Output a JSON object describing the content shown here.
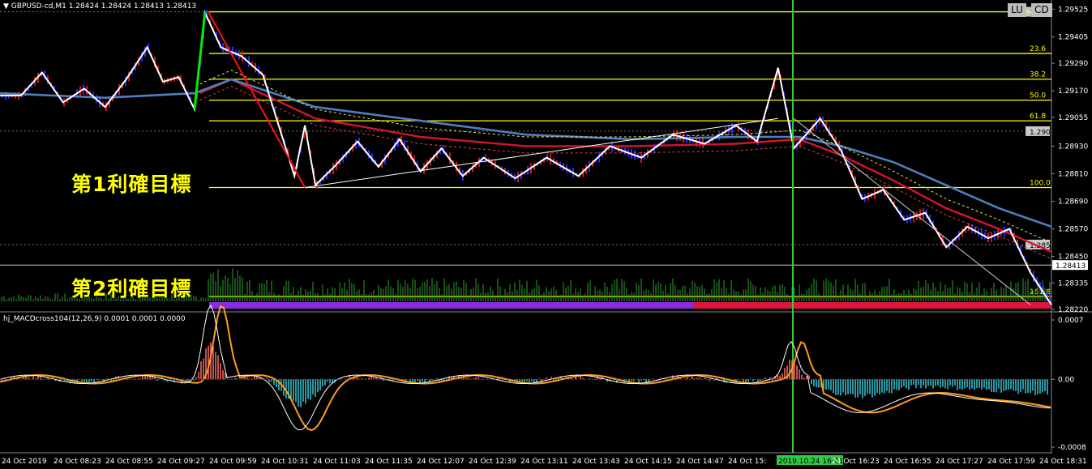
{
  "header": {
    "symbol_title": "GBPUSD-cd,M1  1.28424 1.28424 1.28413 1.28413"
  },
  "buttons": {
    "lu": "LU",
    "cd": "CD"
  },
  "annotations": {
    "target1": "第1利確目標",
    "target2": "第2利確目標"
  },
  "indicator": {
    "title": "hj_MACDcross104(12,26,9) 0.0001 0.0001 0.0000"
  },
  "colors": {
    "background": "#000000",
    "fib_line": "#ffff00",
    "price_zigzag": "#ffffff",
    "ma_blue": "#4f7fbf",
    "ma_red": "#d4142a",
    "swing_up": "#00ee00",
    "swing_down": "#ff1010",
    "vline": "#33cc33",
    "volume": "#2e9e2e",
    "bar_purple": "#8a2be2",
    "bar_red": "#e0143c",
    "macd_signal": "#ff9e1b",
    "macd_line": "#ffffff"
  },
  "chart_data": [
    {
      "type": "line",
      "title": "GBPUSD-cd,M1",
      "price_axis_ticks": [
        "1.29525",
        "1.29405",
        "1.29290",
        "1.29170",
        "1.29055",
        "1.28930",
        "1.28810",
        "1.28690",
        "1.28570",
        "1.28450",
        "1.28335",
        "1.28220"
      ],
      "ylim": [
        1.2822,
        1.2953
      ],
      "price_markers": [
        "1.295",
        "1.290",
        "1.285",
        "1.28413"
      ],
      "fibonacci_levels": [
        {
          "label": "",
          "price": 1.29514
        },
        {
          "label": "23.6",
          "price": 1.29333
        },
        {
          "label": "38.2",
          "price": 1.29221
        },
        {
          "label": "50.0",
          "price": 1.2913
        },
        {
          "label": "61.8",
          "price": 1.2904
        },
        {
          "label": "100.0",
          "price": 1.2875
        },
        {
          "label": "161.8",
          "price": 1.28276
        }
      ],
      "x_tick_labels": [
        "24 Oct 2019",
        "24 Oct 08:23",
        "24 Oct 08:55",
        "24 Oct 09:27",
        "24 Oct 09:59",
        "24 Oct 10:31",
        "24 Oct 11:03",
        "24 Oct 11:35",
        "24 Oct 12:07",
        "24 Oct 12:39",
        "24 Oct 13:11",
        "24 Oct 13:43",
        "24 Oct 14:15",
        "24 Oct 14:47",
        "24 Oct 15:",
        "2019.10.24 16:01",
        "24 Oct 16:23",
        "24 Oct 16:55",
        "24 Oct 17:27",
        "24 Oct 17:59",
        "24 Oct 18:31"
      ],
      "series": [
        {
          "values_xy": [
            [
              0,
              1.2915
            ],
            [
              0.02,
              1.2915
            ],
            [
              0.04,
              1.2925
            ],
            [
              0.06,
              1.2912
            ],
            [
              0.08,
              1.2918
            ],
            [
              0.1,
              1.291
            ],
            [
              0.12,
              1.2922
            ],
            [
              0.14,
              1.2936
            ],
            [
              0.155,
              1.2921
            ],
            [
              0.17,
              1.2923
            ],
            [
              0.185,
              1.2909
            ],
            [
              0.195,
              1.2951
            ],
            [
              0.21,
              1.2936
            ],
            [
              0.23,
              1.2932
            ],
            [
              0.25,
              1.2924
            ],
            [
              0.28,
              1.288
            ],
            [
              0.29,
              1.2902
            ],
            [
              0.3,
              1.2876
            ],
            [
              0.32,
              1.2885
            ],
            [
              0.34,
              1.2895
            ],
            [
              0.36,
              1.2884
            ],
            [
              0.38,
              1.2896
            ],
            [
              0.4,
              1.2882
            ],
            [
              0.42,
              1.2892
            ],
            [
              0.44,
              1.288
            ],
            [
              0.46,
              1.2888
            ],
            [
              0.49,
              1.2879
            ],
            [
              0.52,
              1.2888
            ],
            [
              0.55,
              1.288
            ],
            [
              0.58,
              1.2893
            ],
            [
              0.61,
              1.2888
            ],
            [
              0.64,
              1.2898
            ],
            [
              0.67,
              1.2894
            ],
            [
              0.7,
              1.2902
            ],
            [
              0.72,
              1.2895
            ],
            [
              0.74,
              1.2927
            ],
            [
              0.755,
              1.2892
            ],
            [
              0.78,
              1.2905
            ],
            [
              0.8,
              1.2891
            ],
            [
              0.82,
              1.287
            ],
            [
              0.84,
              1.2874
            ],
            [
              0.86,
              1.2861
            ],
            [
              0.88,
              1.2864
            ],
            [
              0.9,
              1.2849
            ],
            [
              0.92,
              1.2858
            ],
            [
              0.94,
              1.2853
            ],
            [
              0.96,
              1.2857
            ],
            [
              0.98,
              1.2838
            ],
            [
              1.0,
              1.2824
            ]
          ]
        },
        {
          "values_xy": [
            [
              0,
              1.2916
            ],
            [
              0.1,
              1.2914
            ],
            [
              0.185,
              1.2916
            ],
            [
              0.22,
              1.2922
            ],
            [
              0.3,
              1.291
            ],
            [
              0.4,
              1.2904
            ],
            [
              0.5,
              1.2898
            ],
            [
              0.6,
              1.2896
            ],
            [
              0.7,
              1.2897
            ],
            [
              0.76,
              1.2897
            ],
            [
              0.8,
              1.2893
            ],
            [
              0.85,
              1.2886
            ],
            [
              0.9,
              1.2876
            ],
            [
              0.95,
              1.2866
            ],
            [
              1.0,
              1.2858
            ]
          ]
        },
        {
          "values_xy": [
            [
              0.19,
              1.2916
            ],
            [
              0.22,
              1.2922
            ],
            [
              0.3,
              1.2905
            ],
            [
              0.4,
              1.2897
            ],
            [
              0.5,
              1.2893
            ],
            [
              0.6,
              1.2893
            ],
            [
              0.7,
              1.2894
            ],
            [
              0.76,
              1.2896
            ],
            [
              0.8,
              1.2889
            ],
            [
              0.85,
              1.2878
            ],
            [
              0.9,
              1.2866
            ],
            [
              0.95,
              1.2857
            ],
            [
              1.0,
              1.2847
            ]
          ]
        }
      ]
    },
    {
      "type": "bar",
      "title": "hj_MACDcross104(12,26,9)",
      "ylim": [
        -0.0008,
        0.0007
      ],
      "axis_ticks": [
        "0.0007",
        "0.00",
        "-0.0008"
      ]
    }
  ]
}
